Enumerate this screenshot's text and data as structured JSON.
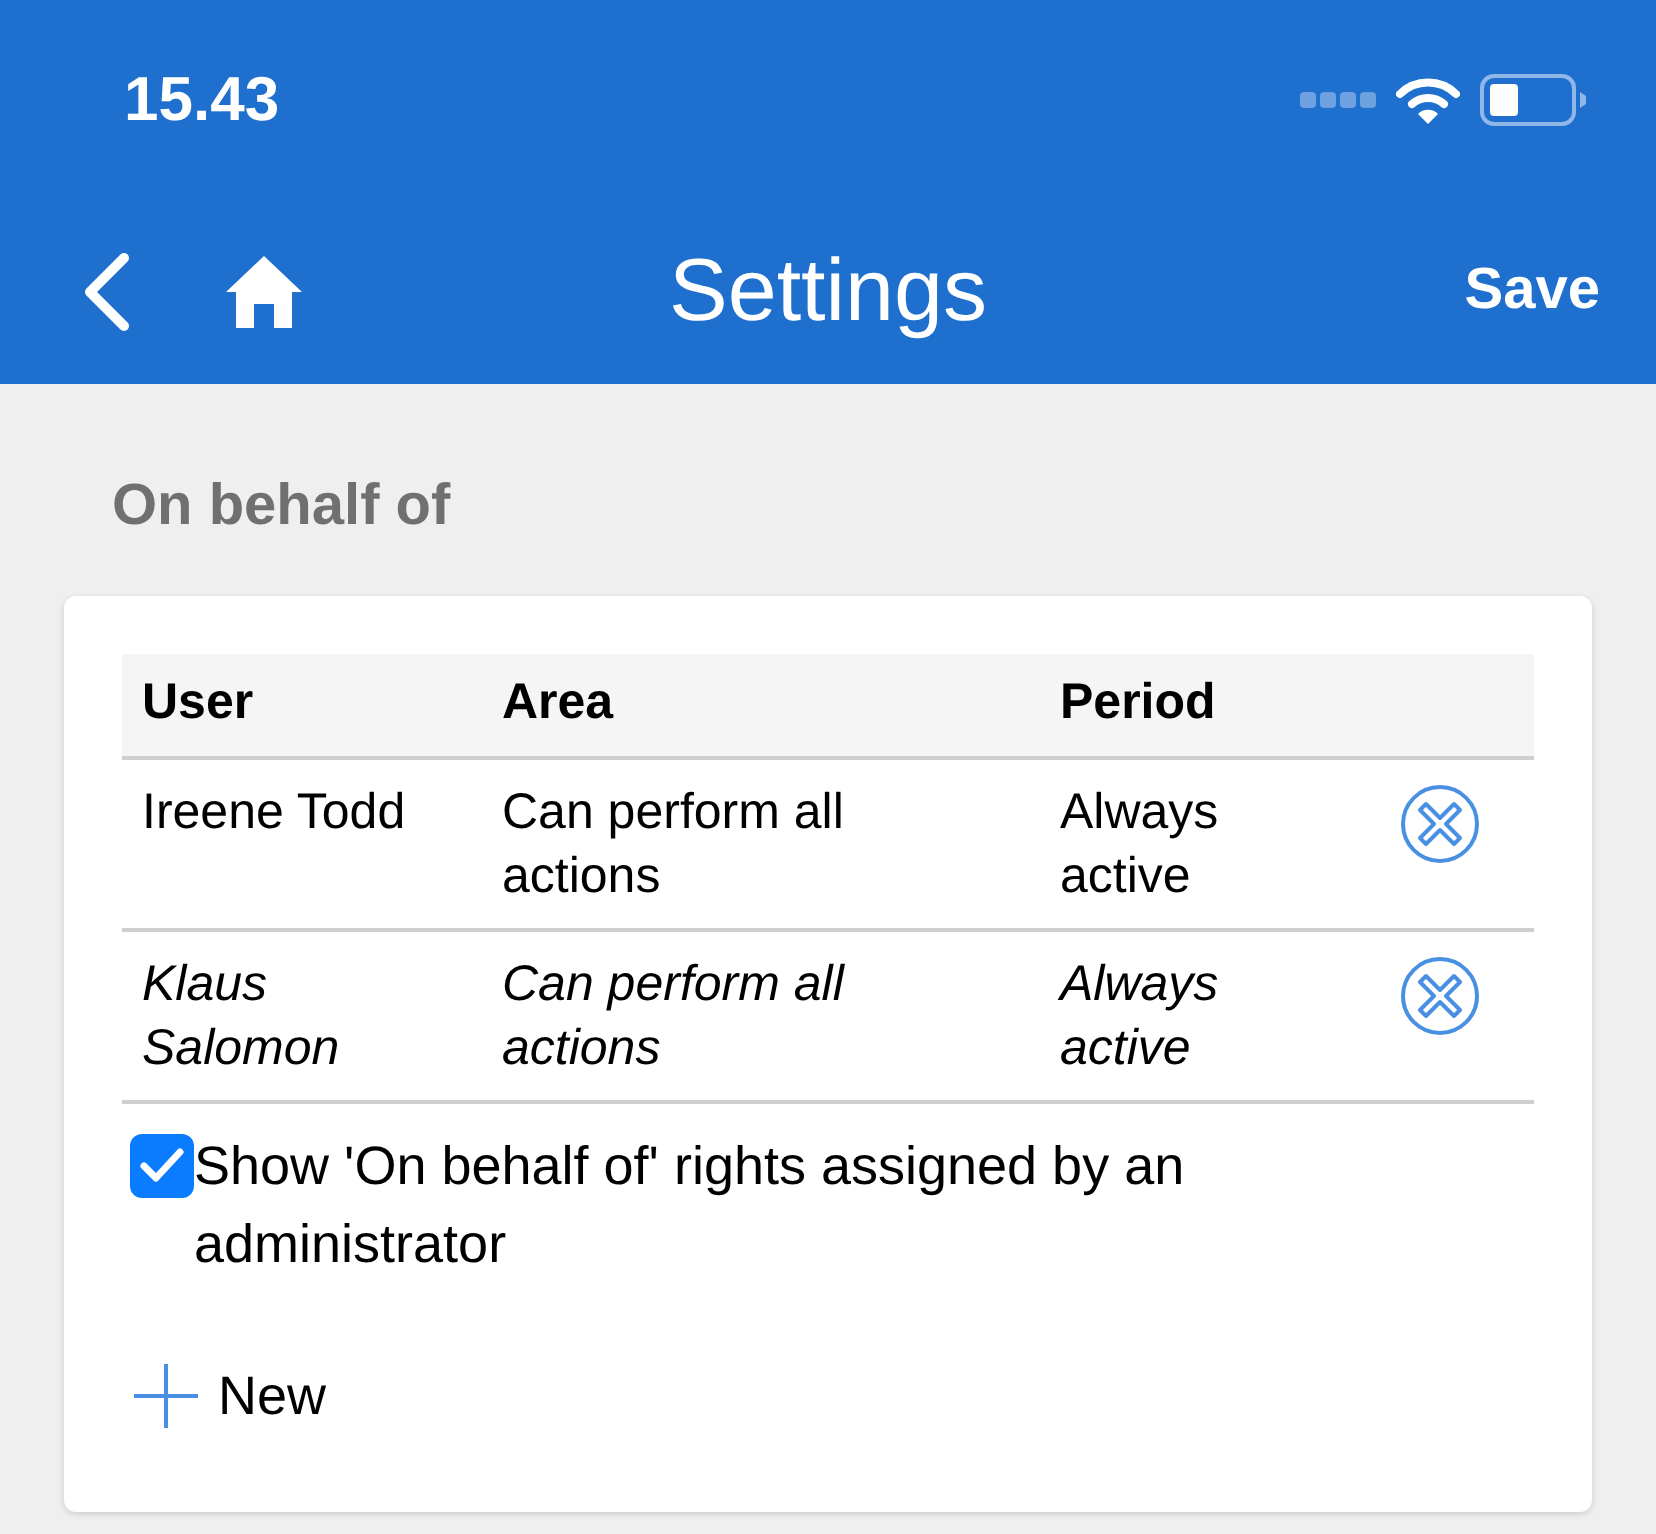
{
  "status_bar": {
    "time": "15.43"
  },
  "nav_bar": {
    "title": "Settings",
    "save": "Save"
  },
  "section": {
    "title": "On behalf of"
  },
  "table": {
    "columns": [
      "User",
      "Area",
      "Period"
    ],
    "rows": [
      {
        "user": "Ireene Todd",
        "area": "Can perform all actions",
        "period": "Always active",
        "admin_assigned": false
      },
      {
        "user": "Klaus Salomon",
        "area": "Can perform all actions",
        "period": "Always active",
        "admin_assigned": true
      }
    ]
  },
  "show_admin_rights": {
    "label": "Show 'On behalf of' rights assigned by an administrator",
    "checked": true
  },
  "new_button": {
    "label": "New"
  }
}
